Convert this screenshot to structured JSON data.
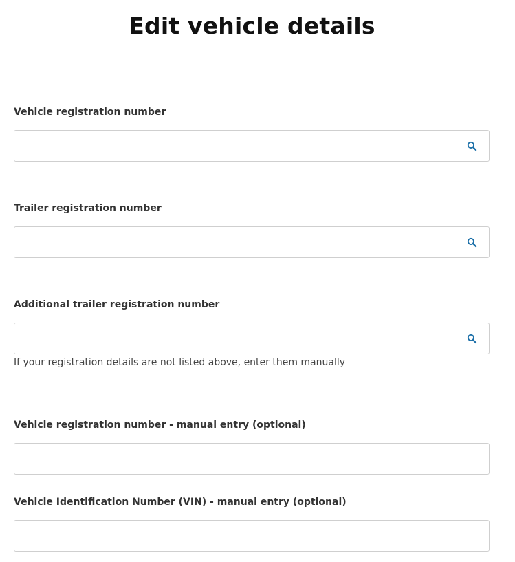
{
  "page": {
    "title": "Edit vehicle details"
  },
  "form": {
    "vehicle_rego": {
      "label": "Vehicle registration number",
      "value": "",
      "placeholder": "",
      "icon": "search-icon"
    },
    "trailer_rego": {
      "label": "Trailer registration number",
      "value": "",
      "placeholder": "",
      "icon": "search-icon"
    },
    "additional_trailer_rego": {
      "label": "Additional trailer registration number",
      "value": "",
      "placeholder": "",
      "icon": "search-icon"
    },
    "hint": "If your registration details are not listed above, enter them manually",
    "manual_rego": {
      "label": "Vehicle registration number - manual entry (optional)",
      "value": "",
      "placeholder": ""
    },
    "manual_vin": {
      "label": "Vehicle Identification Number (VIN) - manual entry (optional)",
      "value": "",
      "placeholder": ""
    }
  },
  "colors": {
    "icon_accent": "#1b6fa8",
    "input_border": "#cfcfcf",
    "text": "#333333"
  }
}
